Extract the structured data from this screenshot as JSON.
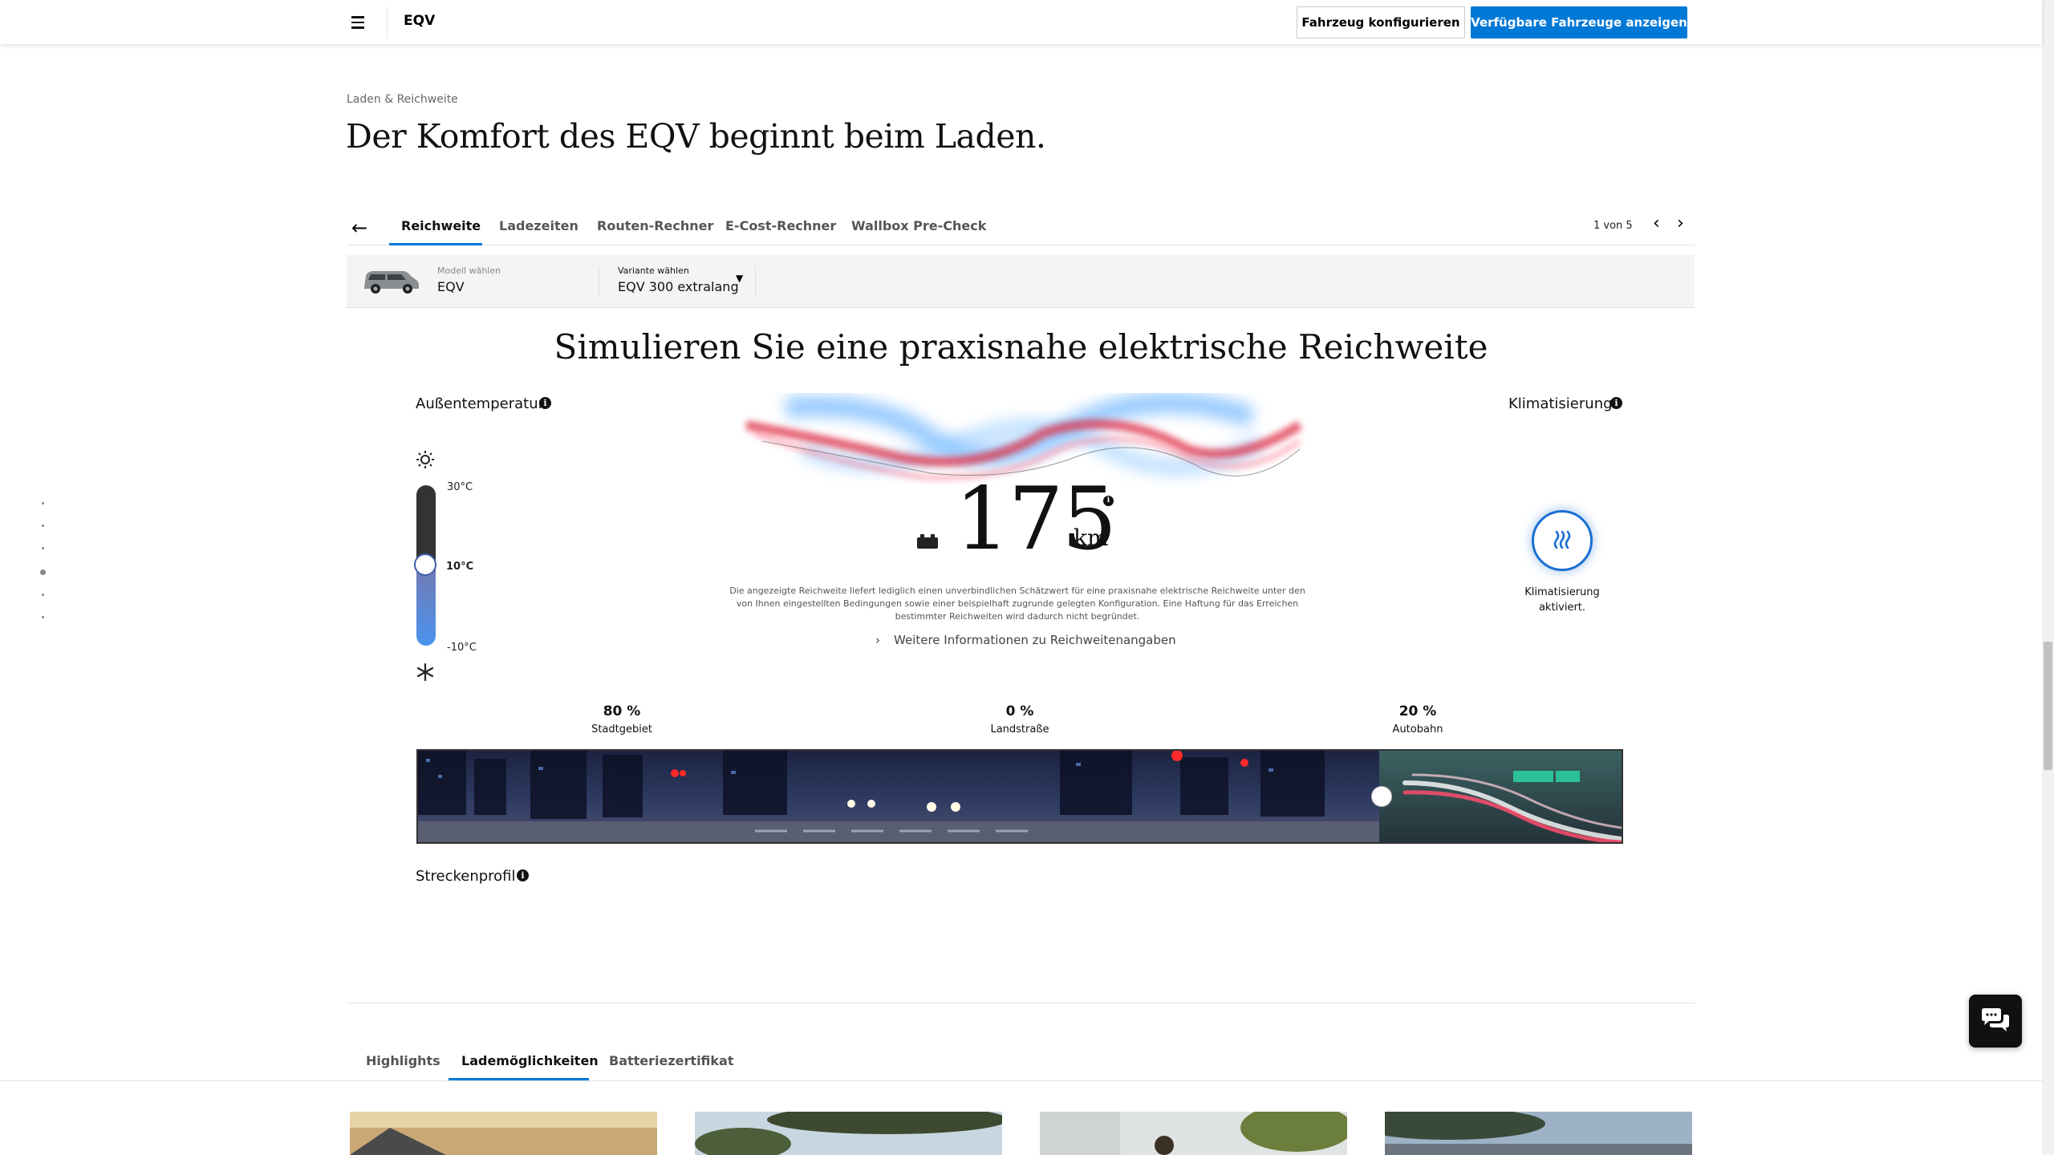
{
  "header": {
    "title": "EQV",
    "configure_button": "Fahrzeug konfigurieren",
    "available_button": "Verfügbare Fahrzeuge anzeigen",
    "accent_color": "#0078d6"
  },
  "section": {
    "eyebrow": "Laden & Reichweite",
    "headline": "Der Komfort des EQV beginnt beim Laden."
  },
  "tabs": {
    "items": [
      {
        "label": "Reichweite",
        "active": true
      },
      {
        "label": "Ladezeiten"
      },
      {
        "label": "Routen-Rechner"
      },
      {
        "label": "E-Cost-Rechner"
      },
      {
        "label": "Wallbox Pre-Check"
      }
    ],
    "pager": "1 von 5"
  },
  "model": {
    "model_label": "Modell wählen",
    "model_value": "EQV",
    "variant_label": "Variante wählen",
    "variant_value": "EQV 300 extralang"
  },
  "simulator": {
    "title": "Simulieren Sie eine praxisnahe elektrische Reichweite",
    "temperature": {
      "label": "Außentemperatur",
      "max": "30°C",
      "current": "10°C",
      "min": "-10°C"
    },
    "climate": {
      "label": "Klimatisierung",
      "status": "Klimatisierung aktiviert."
    },
    "range": {
      "value": "175",
      "unit": "km"
    },
    "disclaimer": "Die angezeigte Reichweite liefert lediglich einen unverbindlichen Schätzwert für eine praxisnahe elektrische Reichweite unter den von Ihnen eingestellten Bedingungen sowie einer beispielhaft zugrunde gelegten Konfiguration. Eine Haftung für das Erreichen bestimmter Reichweiten wird dadurch nicht begründet.",
    "more_info": "Weitere Informationen zu Reichweitenangaben",
    "route": {
      "segments": [
        {
          "percent": "80 %",
          "label": "Stadtgebiet"
        },
        {
          "percent": "0 %",
          "label": "Landstraße"
        },
        {
          "percent": "20 %",
          "label": "Autobahn"
        }
      ],
      "profile_label": "Streckenprofil"
    }
  },
  "bottom_tabs": {
    "items": [
      {
        "label": "Highlights"
      },
      {
        "label": "Lademöglichkeiten",
        "active": true
      },
      {
        "label": "Batteriezertifikat"
      }
    ]
  }
}
